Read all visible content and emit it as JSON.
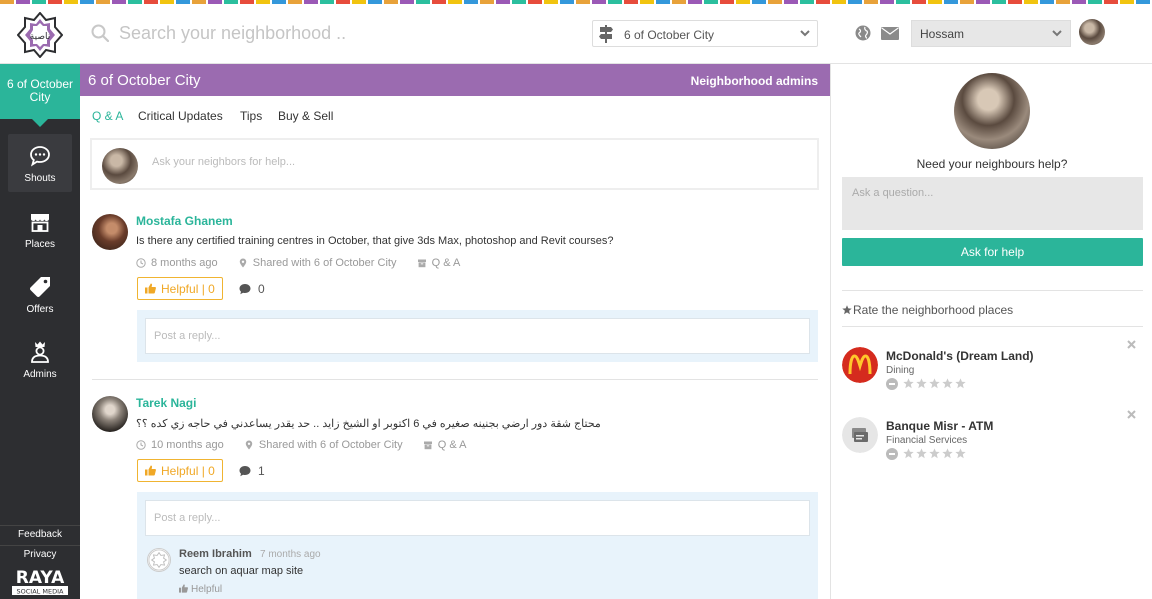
{
  "header": {
    "search_placeholder": "Search your neighborhood ..",
    "city_selected": "6 of October City",
    "user_selected": "Hossam"
  },
  "sidebar": {
    "city_label": "6 of October City",
    "items": [
      {
        "label": "Shouts",
        "icon": "chat-bubble-icon"
      },
      {
        "label": "Places",
        "icon": "store-icon"
      },
      {
        "label": "Offers",
        "icon": "tag-icon"
      },
      {
        "label": "Admins",
        "icon": "crown-user-icon"
      }
    ],
    "footer": {
      "feedback": "Feedback",
      "privacy": "Privacy"
    }
  },
  "banner": {
    "title": "6 of October City",
    "admins_link": "Neighborhood admins"
  },
  "tabs": [
    {
      "label": "Q & A",
      "active": true
    },
    {
      "label": "Critical Updates",
      "active": false
    },
    {
      "label": "Tips",
      "active": false
    },
    {
      "label": "Buy & Sell",
      "active": false
    }
  ],
  "ask_box": {
    "placeholder": "Ask your neighbors for help..."
  },
  "posts": [
    {
      "author": "Mostafa Ghanem",
      "body": "Is there any certified training centres in October, that give 3ds Max, photoshop and Revit courses?",
      "time": "8 months ago",
      "shared": "Shared with 6 of October City",
      "category": "Q & A",
      "helpful_label": "Helpful | 0",
      "comments": "0",
      "reply_placeholder": "Post a reply..."
    },
    {
      "author": "Tarek Nagi",
      "body": "محتاج شقة دور ارضي بجنينه صغيره في 6 اكتوبر او الشيخ زايد .. حد يقدر يساعدني في حاجه زي كده ؟؟",
      "time": "10 months ago",
      "shared": "Shared with 6 of October City",
      "category": "Q & A",
      "helpful_label": "Helpful | 0",
      "comments": "1",
      "reply_placeholder": "Post a reply...",
      "replies": [
        {
          "author": "Reem Ibrahim",
          "time": "7 months ago",
          "text": "search on aquar map site",
          "helpful": "Helpful"
        }
      ]
    }
  ],
  "right_panel": {
    "need_help": "Need your neighbours help?",
    "question_placeholder": "Ask a question...",
    "ask_button": "Ask for help",
    "rate_title": "Rate the neighborhood places",
    "places": [
      {
        "name": "McDonald's (Dream Land)",
        "category": "Dining",
        "rating": 0
      },
      {
        "name": "Banque Misr - ATM",
        "category": "Financial Services",
        "rating": 0
      }
    ]
  },
  "colors": {
    "accent": "#2bb59a",
    "banner": "#9b6bb0",
    "sidebar": "#2d2e31",
    "helpful": "#f0a826"
  }
}
